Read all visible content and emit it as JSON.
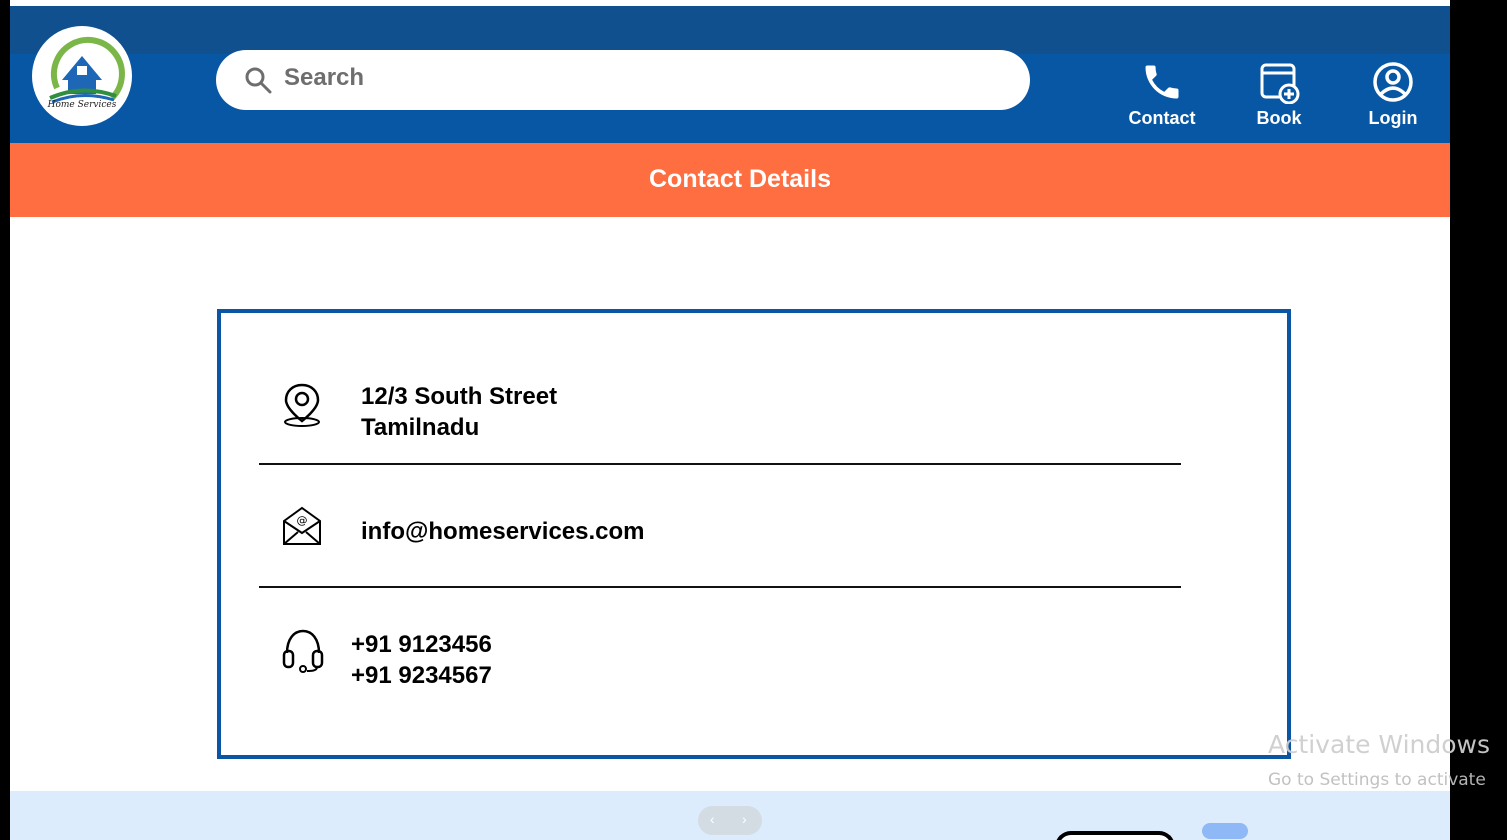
{
  "header": {
    "logo_text": "Home Services",
    "search": {
      "placeholder": "Search"
    },
    "nav": [
      {
        "label": "Contact",
        "icon": "phone-icon"
      },
      {
        "label": "Book",
        "icon": "calendar-add-icon"
      },
      {
        "label": "Login",
        "icon": "user-circle-icon"
      }
    ]
  },
  "banner": {
    "title": "Contact Details"
  },
  "contact": {
    "address_line1": "12/3 South Street",
    "address_line2": "Tamilnadu",
    "email": "info@homeservices.com",
    "phone1": "+91 9123456",
    "phone2": "+91 9234567",
    "icons": [
      "location-pin-icon",
      "mail-icon",
      "headset-icon"
    ]
  },
  "footer": {
    "pager_prev": "‹",
    "pager_next": "›"
  },
  "watermark": {
    "line1": "Activate Windows",
    "line2": "Go to Settings to activate"
  },
  "colors": {
    "header_blue": "#0857a5",
    "header_top": "#10508f",
    "banner_orange": "#ff6e40",
    "card_border": "#0a56a4",
    "footer_bg": "#dcecfd"
  }
}
